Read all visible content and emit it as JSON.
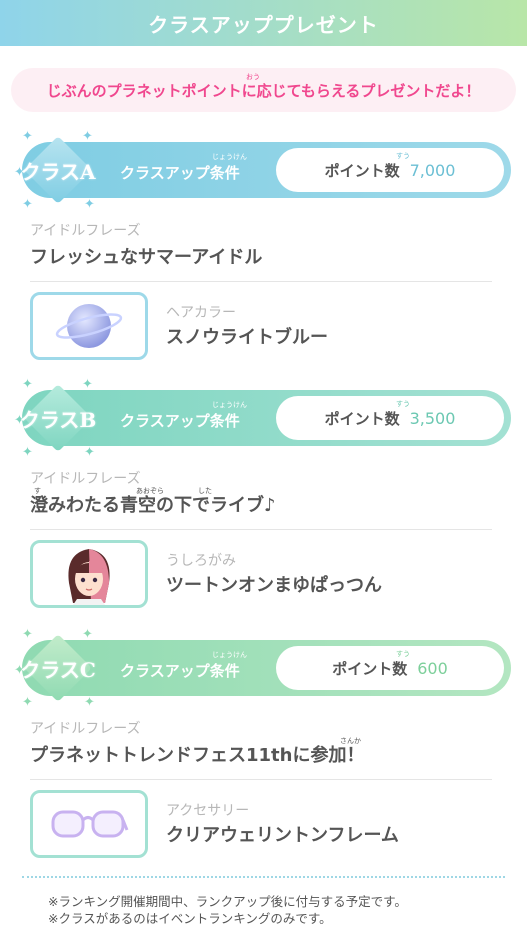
{
  "header": {
    "title": "クラスアッププレゼント"
  },
  "notice": {
    "text": "じぶんのプラネットポイントに応じてもらえるプレゼントだよ！",
    "ruby": "おう"
  },
  "classes": [
    {
      "badge": "クラスA",
      "condition_label": "クラスアップ条件",
      "condition_ruby": "じょうけん",
      "points_label": "ポイント数",
      "points_ruby": "すう",
      "points_value": "7,000",
      "phrase_category": "アイドルフレーズ",
      "phrase": "フレッシュなサマーアイドル",
      "item_category": "ヘアカラー",
      "item_name": "スノウライトブルー",
      "item_icon": "planet-icon"
    },
    {
      "badge": "クラスB",
      "condition_label": "クラスアップ条件",
      "condition_ruby": "じょうけん",
      "points_label": "ポイント数",
      "points_ruby": "すう",
      "points_value": "3,500",
      "phrase_category": "アイドルフレーズ",
      "phrase": "澄みわたる青空の下でライブ♪",
      "phrase_ruby_1": "す",
      "phrase_ruby_2": "あおぞら",
      "phrase_ruby_3": "した",
      "item_category": "うしろがみ",
      "item_name": "ツートンオンまゆぱっつん",
      "item_icon": "hairstyle-icon"
    },
    {
      "badge": "クラスC",
      "condition_label": "クラスアップ条件",
      "condition_ruby": "じょうけん",
      "points_label": "ポイント数",
      "points_ruby": "すう",
      "points_value": "600",
      "phrase_category": "アイドルフレーズ",
      "phrase": "プラネットトレンドフェス11thに参加！",
      "phrase_ruby_1": "さんか",
      "item_category": "アクセサリー",
      "item_name": "クリアウェリントンフレーム",
      "item_icon": "glasses-icon"
    }
  ],
  "footnotes": [
    "※ランキング開催期間中、ランクアップ後に付与する予定です。",
    "※クラスがあるのはイベントランキングのみです。"
  ],
  "colors": {
    "header_start": "#8fd4ea",
    "header_end": "#b8e6a8",
    "notice_bg": "#fdeff4",
    "notice_text": "#f0478e",
    "class_a": "#8cd3e6",
    "class_b": "#8cdcc8",
    "class_c": "#a3e0b0",
    "value_text": "#6bbfd4"
  }
}
